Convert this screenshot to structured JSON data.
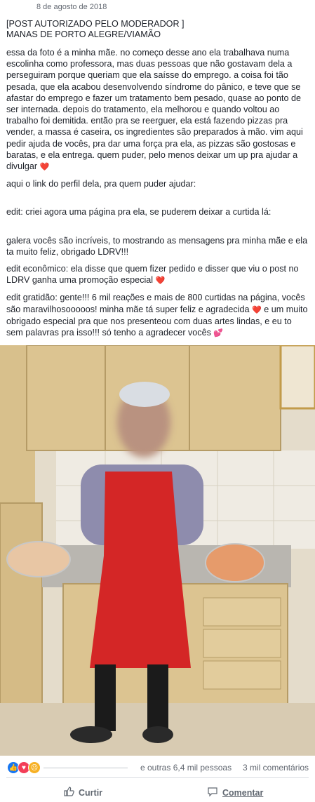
{
  "post": {
    "date": "8 de agosto de 2018",
    "header_line1": "[POST AUTORIZADO PELO MODERADOR                          ]",
    "header_line2": "MANAS DE PORTO ALEGRE/VIAMÃO",
    "paragraphs": [
      "essa da foto é a minha mãe. no começo desse ano ela trabalhava numa escolinha como professora, mas duas pessoas que não gostavam dela a perseguiram porque queriam que ela saísse do emprego. a coisa foi tão pesada, que ela acabou desenvolvendo síndrome do pânico, e teve que se afastar do emprego e fazer um tratamento bem pesado, quase ao ponto de ser internada. depois do tratamento, ela melhorou e quando voltou ao trabalho foi demitida. então pra se reerguer, ela está fazendo pizzas pra vender, a massa é caseira, os ingredientes são preparados à mão. vim aqui pedir ajuda de vocês, pra dar uma força pra ela, as pizzas são gostosas e baratas, e ela entrega. quem puder, pelo menos deixar um up pra ajudar a divulgar",
      "aqui o link do perfil dela, pra quem puder ajudar:",
      "edit: criei agora uma página pra ela, se puderem deixar a curtida lá:",
      "galera vocês são incríveis, to mostrando as mensagens pra minha mãe e ela ta muito feliz, obrigado LDRV!!!",
      "edit econômico: ela disse que quem fizer pedido e disser que viu o post no LDRV ganha uma promoção especial",
      "edit gratidão: gente!!! 6 mil reações e mais de 800 curtidas na página, vocês são maravilhosooooos! minha mãe tá super feliz e agradecida",
      "e um muito obrigado especial pra                              que nos presenteou com duas artes lindas, e eu to sem palavras pra isso!!! só tenho a agradecer vocês"
    ]
  },
  "reactions": {
    "icons": [
      "like-icon",
      "love-icon",
      "sad-icon"
    ],
    "names_text": "e outras 6,4 mil pessoas",
    "comments_text": "3 mil comentários"
  },
  "actions": {
    "like_label": "Curtir",
    "comment_label": "Comentar"
  },
  "colors": {
    "like_blue": "#1877f2",
    "love_red": "#f33e58",
    "sad_yellow": "#f7b125",
    "heart": "#e0245e"
  }
}
